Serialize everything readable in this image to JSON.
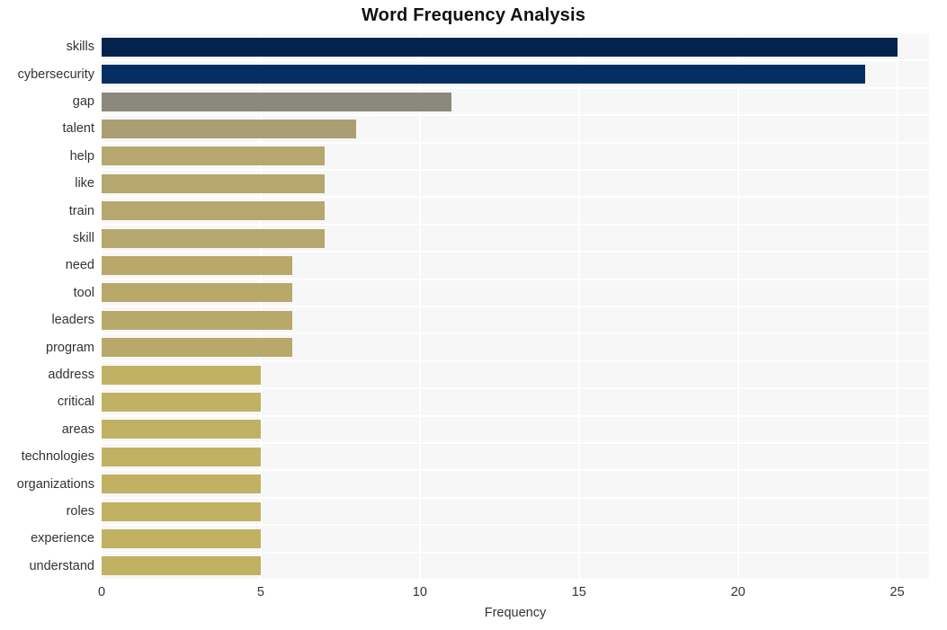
{
  "chart_data": {
    "type": "bar",
    "orientation": "horizontal",
    "title": "Word Frequency Analysis",
    "xlabel": "Frequency",
    "ylabel": "",
    "xlim": [
      0,
      26
    ],
    "ylim": null,
    "grid": true,
    "legend": null,
    "xticks": [
      "0",
      "5",
      "10",
      "15",
      "20",
      "25"
    ],
    "xtick_values": [
      0,
      5,
      10,
      15,
      20,
      25
    ],
    "categories": [
      "skills",
      "cybersecurity",
      "gap",
      "talent",
      "help",
      "like",
      "train",
      "skill",
      "need",
      "tool",
      "leaders",
      "program",
      "address",
      "critical",
      "areas",
      "technologies",
      "organizations",
      "roles",
      "experience",
      "understand"
    ],
    "values": [
      25,
      24,
      11,
      8,
      7,
      7,
      7,
      7,
      6,
      6,
      6,
      6,
      5,
      5,
      5,
      5,
      5,
      5,
      5,
      5
    ],
    "bar_colors": [
      "#04234c",
      "#052f62",
      "#8b897e",
      "#aa9e72",
      "#b5a76e",
      "#b5a76e",
      "#b5a76e",
      "#b5a76e",
      "#b8a96a",
      "#b8a96a",
      "#b8a96a",
      "#b8a96a",
      "#c0b163",
      "#c0b163",
      "#c0b163",
      "#c0b163",
      "#c0b163",
      "#c0b163",
      "#c0b163",
      "#c0b163"
    ]
  },
  "style": {
    "plot_background": "#f7f7f7",
    "gridline_color": "#ffffff",
    "figure_background": "#ffffff",
    "title_color": "#111111",
    "tick_label_color": "#333333"
  }
}
